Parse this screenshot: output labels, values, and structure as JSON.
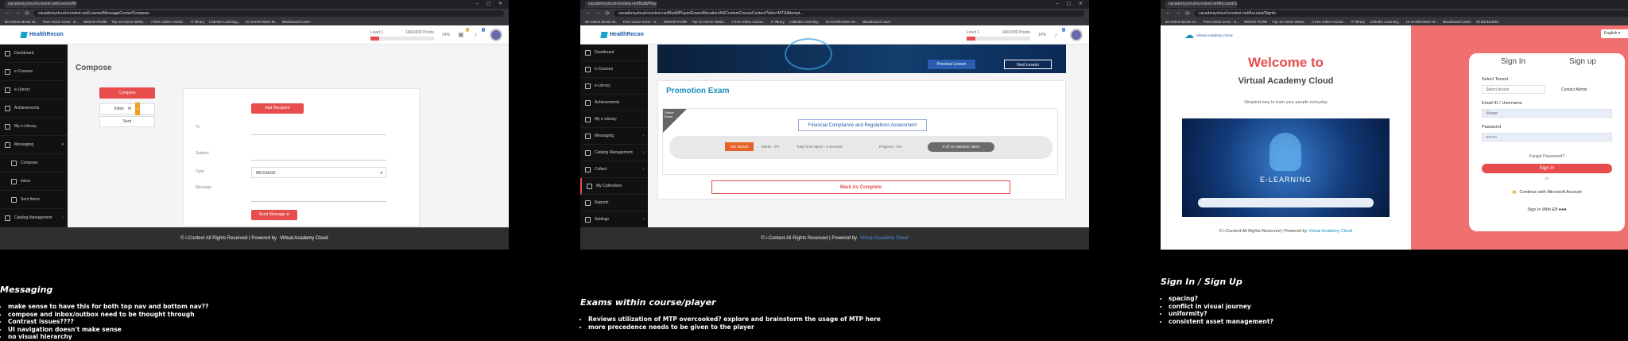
{
  "browser": {
    "tabs": [
      "60 Online Movie St...",
      "Free vector icons - S...",
      "Nithesh Profile",
      "Top 10 Anime Webs..."
    ],
    "urls": [
      "vacademycloud-icontext.net/Learner/MessageCenter/Compose",
      "vacademycloud-icontext.net/Build/Player/ExamAllocation/All/ContentCourseContent?tabs=MTSAttempt...",
      "vacademycloud-icontext.net/Account/SignIn"
    ],
    "bookmarks": [
      "60 Online Movie St...",
      "Free vector icons - S...",
      "Nithesh Profile",
      "Top 10 Anime Webs...",
      "A free online course...",
      "IT library",
      "LinkedIn Learning...",
      "10 SAHRASIDA M...",
      "Blackboard Learn",
      "All Bookmarks"
    ]
  },
  "app": {
    "logo": "HealthRecon",
    "level_label": "Level 1",
    "level_points": "140/1000 Points",
    "level_pct": "14%",
    "level_fill": 0.14,
    "cart_count": "0",
    "notif_count": "5"
  },
  "panel1": {
    "sidebar": [
      "Dashboard",
      "e-Courses",
      "e-Library",
      "Achievements",
      "My e-Library",
      "Messaging",
      "Compose",
      "Inbox",
      "Sent Items",
      "Catalog Management"
    ],
    "title": "Compose",
    "compose_btn": "Compose",
    "inbox_btn": "Inbox",
    "inbox_count": "0",
    "sent_btn": "Sent",
    "add_recipient": "Add Recipient",
    "to_label": "To",
    "subject_label": "Subject",
    "type_label": "Type",
    "type_value": "MESSAGE",
    "message_label": "Message",
    "send_btn": "Send Message"
  },
  "panel2": {
    "sidebar": [
      "Dashboard",
      "e-Courses",
      "e-Library",
      "Achievements",
      "My e-Library",
      "Messaging",
      "Catalog Management",
      "Collect",
      "My Collections",
      "Reports",
      "Settings"
    ],
    "prev_lesson": "Previous Lesson",
    "next_lesson": "Next Lesson",
    "exam_title": "Promotion Exam",
    "ribbon": "Online Exam",
    "course_name": "Financial Compliance and Regulations Assessment",
    "status": "Not Started",
    "marks": "Marks :   0%",
    "time_spent": "Total Time Spent :   0 seconds",
    "progress": "Progress :   0%",
    "attempts": "0 Of 10 Attempts Taken",
    "mark_complete": "Mark As Complete"
  },
  "panel3": {
    "brand": "Virtual Academy Cloud",
    "welcome": "Welcome to",
    "welcome_sub": "Virtual Academy Cloud",
    "tagline": "Simplest way to train your people everyday",
    "elearning": "E-LEARNING",
    "language": "English",
    "signin_tab": "Sign In",
    "signup_tab": "Sign up",
    "tenant_label": "Select Tenant",
    "tenant_placeholder": "Select tenant",
    "contact_admin": "Contact Admin",
    "email_label": "Email ID / Username",
    "email_value": "Viewer",
    "password_label": "Password",
    "password_value": "••••••••",
    "forgot": "Forgot Password?",
    "signin_btn": "Sign In",
    "or": "or",
    "microsoft_btn": "Continue with Microsoft Account",
    "signin_ef": "Sign In With Eff ●●●",
    "footer": "© i-Context All Rights Reserved | Powered by",
    "footer_link": "Virtual Academy Cloud"
  },
  "footers": {
    "text": "© i-Context All Rights Reserved | Powered by",
    "link": "Virtual Academy Cloud"
  },
  "notes": {
    "p1": {
      "title": "Messaging",
      "items": [
        "make sense to have this for both top nav and bottom nav??",
        "compose and inbox/outbox need to be thought through",
        "Contrast issues????",
        "UI navigation doesn't make sense",
        "no visual hierarchy"
      ]
    },
    "p2": {
      "title": "Exams within course/player",
      "items": [
        "Reviews utilization of MTP overcooked? explore and brainstorm the usage of MTP here",
        "more precedence needs to be given to the player"
      ]
    },
    "p3": {
      "title": "Sign In / Sign Up",
      "items": [
        "spacing?",
        "conflict in visual journey",
        "uniformity?",
        "consistent asset management?"
      ]
    }
  }
}
